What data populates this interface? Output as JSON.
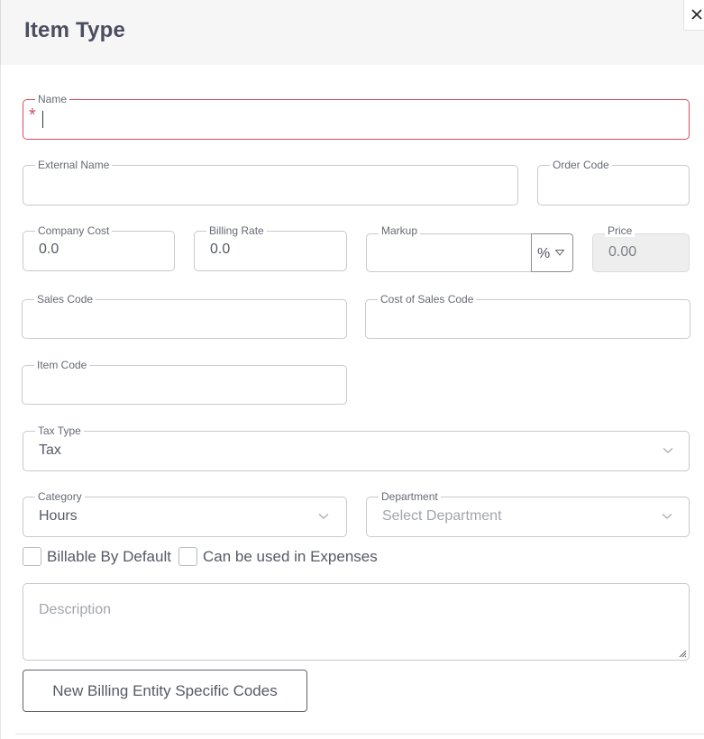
{
  "dialog": {
    "title": "Item Type"
  },
  "fields": {
    "name": {
      "label": "Name",
      "value": "",
      "required_mark": "*"
    },
    "external_name": {
      "label": "External Name",
      "value": ""
    },
    "order_code": {
      "label": "Order Code",
      "value": ""
    },
    "company_cost": {
      "label": "Company Cost",
      "value": "0.0"
    },
    "billing_rate": {
      "label": "Billing Rate",
      "value": "0.0"
    },
    "markup": {
      "label": "Markup",
      "value": "",
      "unit": "%"
    },
    "price": {
      "label": "Price",
      "value": "0.00"
    },
    "sales_code": {
      "label": "Sales Code",
      "value": ""
    },
    "cost_of_sales_code": {
      "label": "Cost of Sales Code",
      "value": ""
    },
    "item_code": {
      "label": "Item Code",
      "value": ""
    },
    "tax_type": {
      "label": "Tax Type",
      "value": "Tax"
    },
    "category": {
      "label": "Category",
      "value": "Hours"
    },
    "department": {
      "label": "Department",
      "placeholder": "Select Department"
    }
  },
  "checkboxes": {
    "billable_by_default": {
      "label": "Billable By Default",
      "checked": false
    },
    "can_be_used_in_expenses": {
      "label": "Can be used in Expenses",
      "checked": false
    }
  },
  "description": {
    "placeholder": "Description"
  },
  "actions": {
    "new_codes_label": "New Billing Entity Specific Codes"
  },
  "colors": {
    "required": "#d94c5f",
    "text": "#555a66",
    "border": "#c9c9cf",
    "header_bg": "#f6f6f7"
  }
}
